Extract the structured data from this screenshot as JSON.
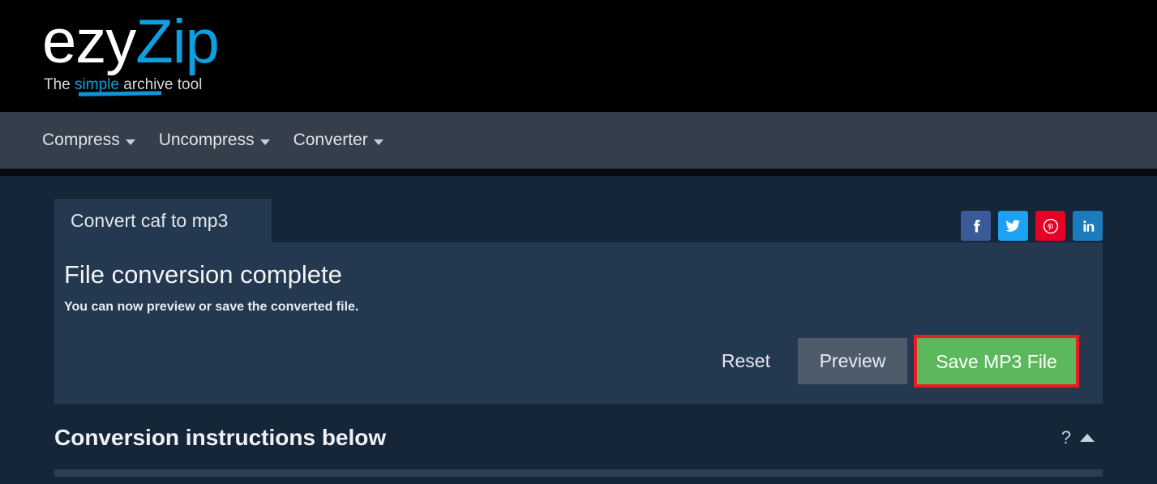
{
  "header": {
    "logo": {
      "part_one": "ezy",
      "part_two": "Zip",
      "tagline_prefix": "The ",
      "tagline_highlight": "simple",
      "tagline_suffix": " archive tool"
    }
  },
  "nav": {
    "items": [
      {
        "label": "Compress",
        "icon": "chevron-down-icon"
      },
      {
        "label": "Uncompress",
        "icon": "chevron-down-icon"
      },
      {
        "label": "Converter",
        "icon": "chevron-down-icon"
      }
    ]
  },
  "card": {
    "tab_label": "Convert caf to mp3",
    "heading": "File conversion complete",
    "subtext": "You can now preview or save the converted file.",
    "actions": {
      "reset_label": "Reset",
      "preview_label": "Preview",
      "save_label": "Save MP3 File"
    },
    "social": [
      {
        "name": "facebook",
        "label": "f",
        "color": "#3b5a98"
      },
      {
        "name": "twitter",
        "label": "t",
        "color": "#1da1f2"
      },
      {
        "name": "pinterest",
        "label": "p",
        "color": "#e60023"
      },
      {
        "name": "linkedin",
        "label": "in",
        "color": "#1c7bbd"
      }
    ]
  },
  "instructions": {
    "title": "Conversion instructions below",
    "help_label": "?",
    "collapse_icon": "chevron-up-icon"
  },
  "colors": {
    "page_background": "#152638",
    "header_background": "#000000",
    "nav_background": "#343f4b",
    "card_background": "#243850",
    "accent_blue": "#0d9fe0",
    "save_green": "#5cb85c",
    "highlight_red": "#ef1b20",
    "preview_gray": "#4e5b6b"
  }
}
